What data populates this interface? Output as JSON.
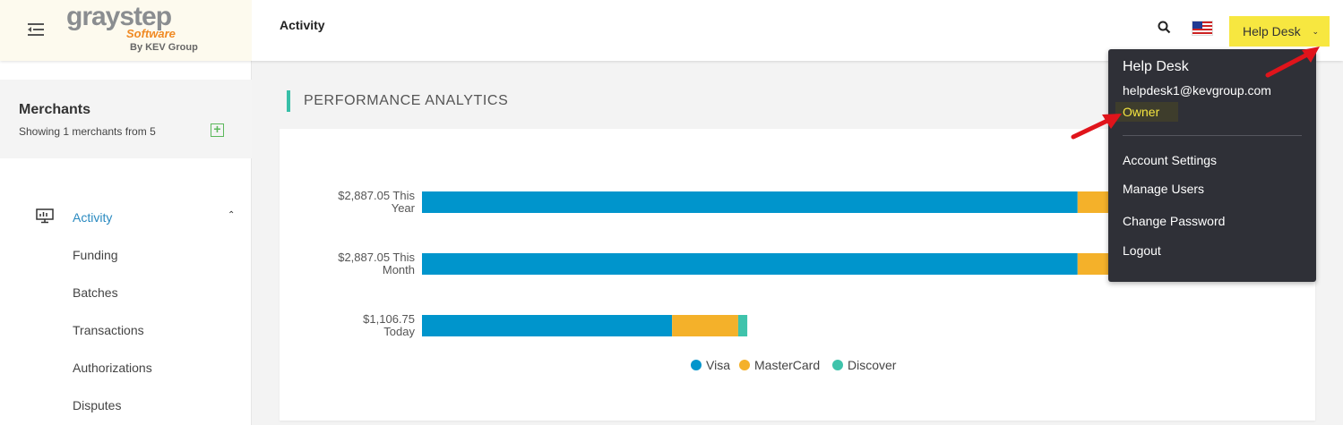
{
  "header": {
    "logo_text": "graystep",
    "logo_subtext": "Software",
    "logo_byline": "By KEV Group",
    "page_title": "Activity",
    "user_button_label": "Help Desk",
    "search_icon": "search-icon",
    "flag_icon": "us-flag-icon"
  },
  "sidebar": {
    "merchants_title": "Merchants",
    "merchants_subtitle": "Showing 1 merchants from 5",
    "activity_label": "Activity",
    "items": [
      "Funding",
      "Batches",
      "Transactions",
      "Authorizations",
      "Disputes"
    ]
  },
  "main": {
    "section_title": "PERFORMANCE ANALYTICS"
  },
  "dropdown": {
    "name": "Help Desk",
    "email": "helpdesk1@kevgroup.com",
    "role": "Owner",
    "items": [
      "Account Settings",
      "Manage Users",
      "Change Password",
      "Logout"
    ]
  },
  "colors": {
    "accent_yellow": "#f7e740",
    "visa": "#0095cc",
    "mastercard": "#f4b12a",
    "discover": "#3fc3ab",
    "activity_link": "#2a8ac0",
    "annotation_arrow": "#e0141b"
  },
  "chart_data": {
    "type": "bar",
    "orientation": "horizontal",
    "stacked": true,
    "categories": [
      [
        "$2,887.05 This",
        "Year"
      ],
      [
        "$2,887.05 This",
        "Month"
      ],
      [
        "$1,106.75",
        "Today"
      ]
    ],
    "series": [
      {
        "name": "Visa",
        "color": "#0095cc",
        "values": [
          2231,
          2231,
          851
        ]
      },
      {
        "name": "MasterCard",
        "color": "#f4b12a",
        "values": [
          532,
          532,
          225
        ]
      },
      {
        "name": "Discover",
        "color": "#3fc3ab",
        "values": [
          124,
          124,
          31
        ]
      }
    ],
    "legend": [
      "Visa",
      "MasterCard",
      "Discover"
    ],
    "legend_position": "bottom"
  }
}
